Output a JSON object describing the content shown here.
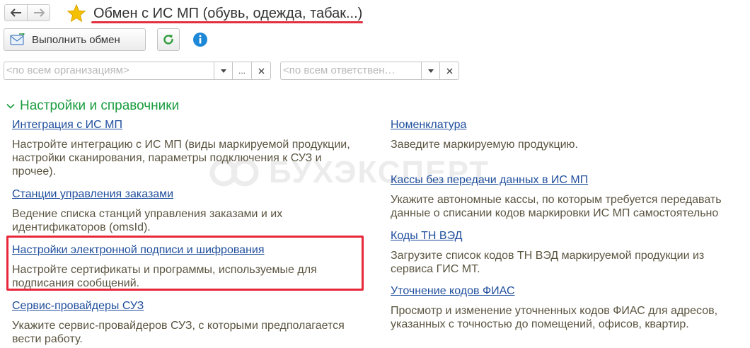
{
  "toolbar": {
    "title": "Обмен с ИС МП (обувь, одежда, табак...)",
    "exchange_button_label": "Выполнить обмен"
  },
  "filters": {
    "organization": {
      "placeholder": "<по всем организациям>",
      "ellipsis": "..."
    },
    "responsible": {
      "placeholder": "<по всем ответствен…"
    }
  },
  "section": {
    "title": "Настройки и справочники"
  },
  "left_items": [
    {
      "link": "Интеграция с ИС МП",
      "desc_lines": [
        "Настройте интеграцию с ИС МП (виды маркируемой продукции,",
        "настройки сканирования, параметры подключения к СУЗ и",
        "прочее)."
      ]
    },
    {
      "link": "Станции управления заказами",
      "desc_lines": [
        "Ведение списка станций управления заказами и их",
        "идентификаторов (omsId)."
      ]
    },
    {
      "link": "Настройки электронной подписи и шифрования",
      "desc_lines": [
        "Настройте сертификаты и программы, используемые для",
        "подписания сообщений."
      ]
    },
    {
      "link": "Сервис-провайдеры СУЗ",
      "desc_lines": [
        "Укажите сервис-провайдеров СУЗ, с которыми предполагается",
        "вести работу."
      ]
    }
  ],
  "right_items": [
    {
      "link": "Номенклатура",
      "desc_lines": [
        "Заведите маркируемую продукцию."
      ]
    },
    {
      "link": "Кассы без передачи данных в ИС МП",
      "desc_lines": [
        "Укажите автономные кассы, по которым требуется передавать",
        "данные о списании кодов маркировки ИС МП самостоятельно"
      ]
    },
    {
      "link": "Коды ТН ВЭД",
      "desc_lines": [
        "Загрузите список кодов ТН ВЭД маркируемой продукции из",
        "сервиса ГИС МТ."
      ]
    },
    {
      "link": "Уточнение кодов ФИАС",
      "desc_lines": [
        "Просмотр и изменение уточненных кодов ФИАС для адресов,",
        "указанных с точностью до помещений, офисов, квартир."
      ]
    }
  ],
  "watermark": {
    "text": "БУХЭКСПЕРТ"
  },
  "colors": {
    "accent_green": "#1a9d3f",
    "link_blue": "#1f4e9d",
    "description": "#5b5440",
    "highlight_red": "#e8283a",
    "star": "#f5c000"
  }
}
